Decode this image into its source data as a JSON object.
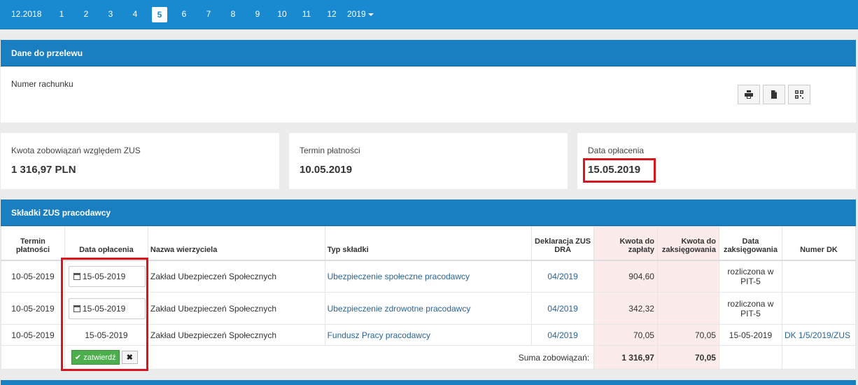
{
  "topbar": {
    "prev_year": "12.2018",
    "months": [
      "1",
      "2",
      "3",
      "4",
      "5",
      "6",
      "7",
      "8",
      "9",
      "10",
      "11",
      "12"
    ],
    "active_month": "5",
    "next_year": "2019"
  },
  "transfer": {
    "title": "Dane do przelewu",
    "account_label": "Numer rachunku",
    "icons": [
      "print-icon",
      "file-icon",
      "qr-code-icon"
    ]
  },
  "summary": {
    "amount_label": "Kwota zobowiązań względem ZUS",
    "amount_value": "1 316,97 PLN",
    "due_label": "Termin płatności",
    "due_value": "10.05.2019",
    "paid_label": "Data opłacenia",
    "paid_value": "15.05.2019"
  },
  "contributions": {
    "title": "Składki ZUS pracodawcy",
    "headers": {
      "due": "Termin płatności",
      "paid": "Data opłacenia",
      "creditor": "Nazwa wierzyciela",
      "type": "Typ składki",
      "decl": "Deklaracja ZUS DRA",
      "to_pay": "Kwota do zapłaty",
      "to_post": "Kwota do zaksięgowania",
      "post_date": "Data zaksięgowania",
      "dk": "Numer DK"
    },
    "rows": [
      {
        "due": "10-05-2019",
        "paid": "15-05-2019",
        "creditor": "Zakład Ubezpieczeń Społecznych",
        "type": "Ubezpieczenie społeczne pracodawcy",
        "decl": "04/2019",
        "to_pay": "904,60",
        "to_post": "",
        "post_date": "rozliczona w PIT-5",
        "dk": ""
      },
      {
        "due": "10-05-2019",
        "paid": "15-05-2019",
        "creditor": "Zakład Ubezpieczeń Społecznych",
        "type": "Ubezpieczenie zdrowotne pracodawcy",
        "decl": "04/2019",
        "to_pay": "342,32",
        "to_post": "",
        "post_date": "rozliczona w PIT-5",
        "dk": ""
      },
      {
        "due": "10-05-2019",
        "paid": "15-05-2019",
        "creditor": "Zakład Ubezpieczeń Społecznych",
        "type": "Fundusz Pracy pracodawcy",
        "decl": "04/2019",
        "to_pay": "70,05",
        "to_post": "70,05",
        "post_date": "15-05-2019",
        "dk": "DK 1/5/2019/ZUS"
      }
    ],
    "confirm_label": "zatwierdź",
    "sum_label": "Suma zobowiązań:",
    "sum_to_pay": "1 316,97",
    "sum_to_post": "70,05"
  }
}
